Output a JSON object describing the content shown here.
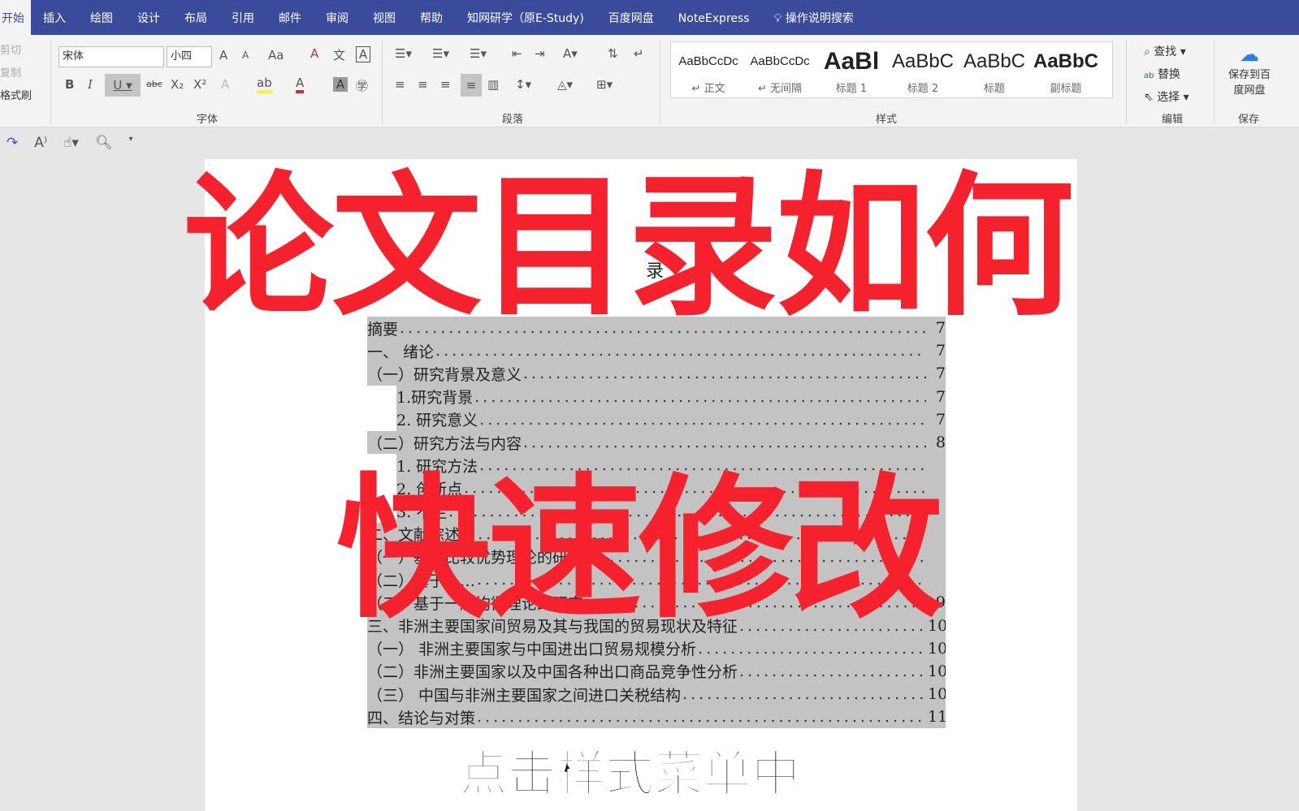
{
  "tabs": [
    "开始",
    "插入",
    "绘图",
    "设计",
    "布局",
    "引用",
    "邮件",
    "审阅",
    "视图",
    "帮助",
    "知网研学（原E-Study)",
    "百度网盘",
    "NoteExpress"
  ],
  "tell_me": "操作说明搜索",
  "clipboard": {
    "cut": "剪切",
    "copy": "复制",
    "format_painter": "格式刷"
  },
  "font": {
    "name": "宋体",
    "size": "小四",
    "group_label": "字体"
  },
  "paragraph": {
    "group_label": "段落"
  },
  "styles": {
    "group_label": "样式",
    "items": [
      {
        "sample": "AaBbCcDc",
        "name": "↵ 正文"
      },
      {
        "sample": "AaBbCcDc",
        "name": "↵ 无间隔"
      },
      {
        "sample": "AaBl",
        "name": "标题 1"
      },
      {
        "sample": "AaBbC",
        "name": "标题 2"
      },
      {
        "sample": "AaBbC",
        "name": "标题"
      },
      {
        "sample": "AaBbC",
        "name": "副标题"
      }
    ]
  },
  "editing": {
    "find": "查找",
    "replace": "替换",
    "select": "选择",
    "group_label": "编辑"
  },
  "save": {
    "button": "保存到百度网盘",
    "group_label": "保存"
  },
  "document": {
    "title_char": "录",
    "toc": [
      {
        "text": "摘要",
        "page": "7",
        "indent": 0
      },
      {
        "text": "一、  绪论",
        "page": "7",
        "indent": 0
      },
      {
        "text": "（一）研究背景及意义",
        "page": "7",
        "indent": 0
      },
      {
        "text": "1.研究背景",
        "page": "7",
        "indent": 36
      },
      {
        "text": "2. 研究意义",
        "page": "7",
        "indent": 36
      },
      {
        "text": "（二）研究方法与内容",
        "page": "8",
        "indent": 0
      },
      {
        "text": "1. 研究方法",
        "page": "",
        "indent": 36
      },
      {
        "text": "2. 创新点",
        "page": "",
        "indent": 36
      },
      {
        "text": "3. 不足",
        "page": "",
        "indent": 36
      },
      {
        "text": "二、文献综述",
        "page": "",
        "indent": 0
      },
      {
        "text": "（一）基于比较优势理论的研究",
        "page": "",
        "indent": 0
      },
      {
        "text": "（二）基于……",
        "page": "",
        "indent": 0
      },
      {
        "text": "（三）基于一般均衡理论的研究",
        "page": "9",
        "indent": 0
      },
      {
        "text": "三、非洲主要国家间贸易及其与我国的贸易现状及特征",
        "page": "10",
        "indent": 0
      },
      {
        "text": "（一）  非洲主要国家与中国进出口贸易规模分析",
        "page": "10",
        "indent": 0
      },
      {
        "text": "（二）非洲主要国家以及中国各种出口商品竞争性分析",
        "page": "10",
        "indent": 0
      },
      {
        "text": "（三）  中国与非洲主要国家之间进口关税结构",
        "page": "10",
        "indent": 0
      },
      {
        "text": "四、结论与对策",
        "page": "11",
        "indent": 0
      }
    ]
  },
  "overlay": {
    "line1": "论文目录如何",
    "line2": "快速修改",
    "caption": "点击样式菜单中",
    "color": "#f5222e"
  }
}
